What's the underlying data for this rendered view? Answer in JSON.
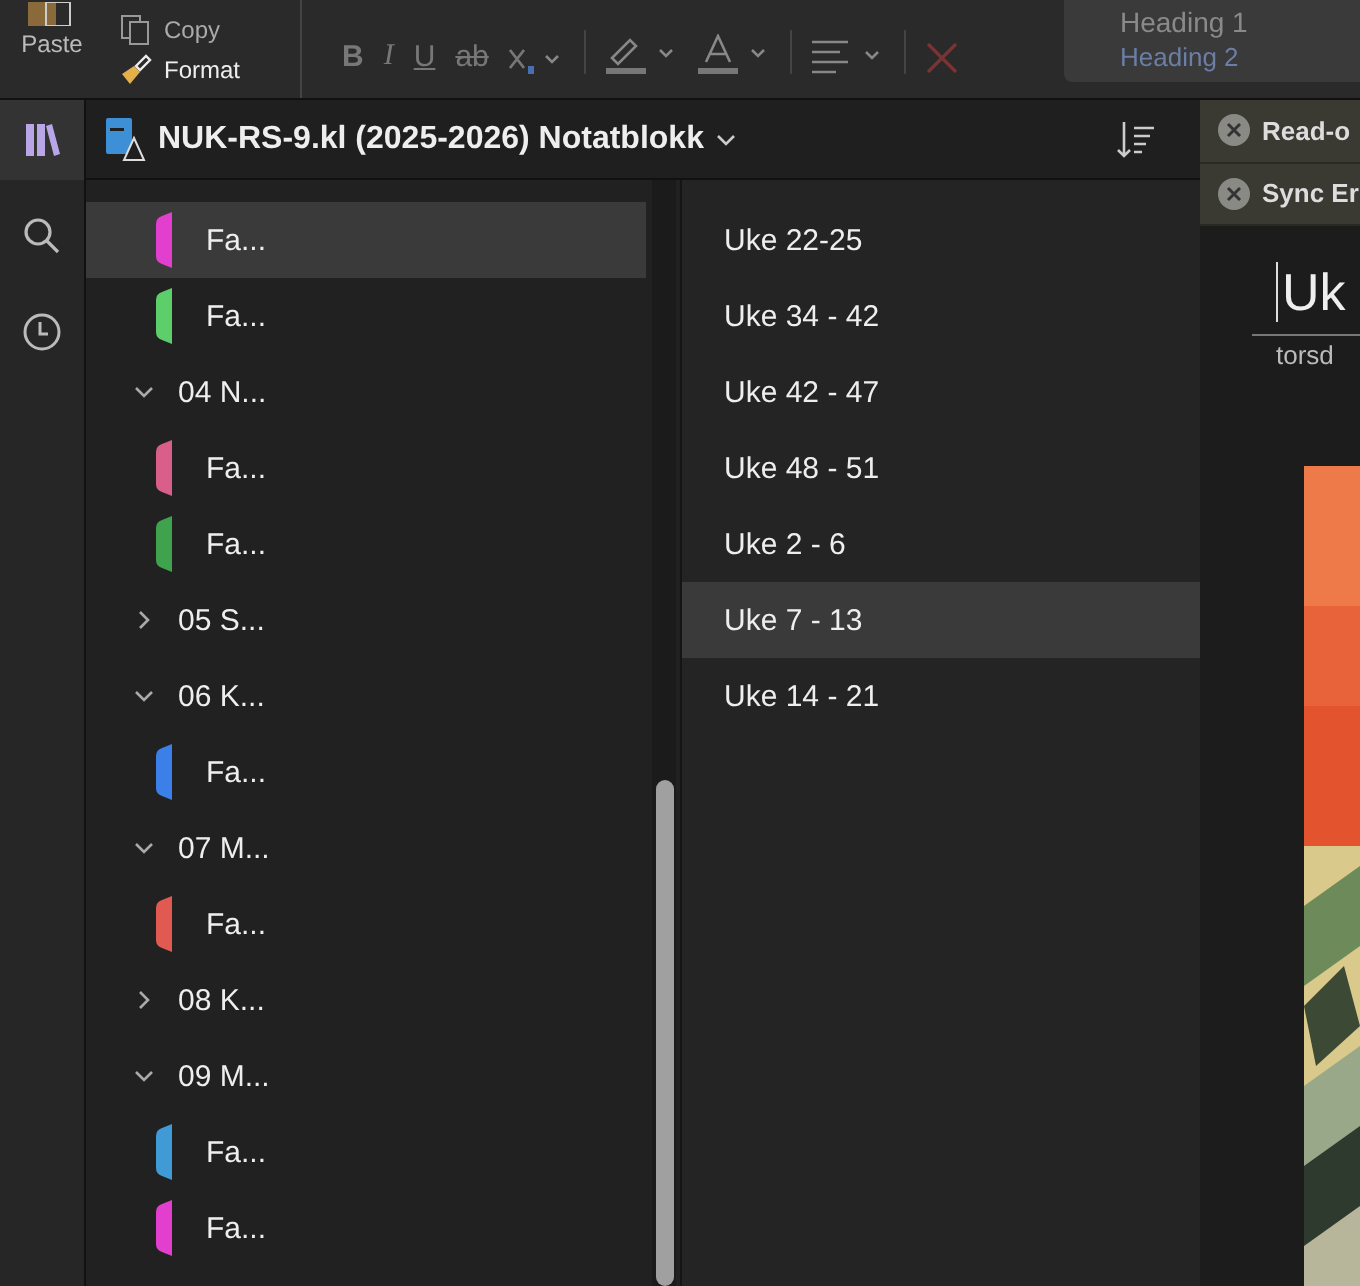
{
  "ribbon": {
    "clipboard": {
      "paste": "Paste",
      "copy": "Copy",
      "format": "Format"
    },
    "font_buttons": [
      {
        "label": "B",
        "kind": "bold"
      },
      {
        "label": "I",
        "kind": "italic"
      },
      {
        "label": "U",
        "kind": "underline"
      },
      {
        "label": "ab",
        "kind": "strike"
      }
    ],
    "styles": [
      "Heading 1",
      "Heading 2"
    ]
  },
  "notebook": {
    "title": "NUK-RS-9.kl (2025-2026) Notatblokk"
  },
  "rail": [
    {
      "kind": "notebooks",
      "selected": true
    },
    {
      "kind": "search",
      "selected": false
    },
    {
      "kind": "recent",
      "selected": false
    }
  ],
  "sections": [
    {
      "kind": "section",
      "label": "Fa...",
      "color": "#e23fcf",
      "selected": true
    },
    {
      "kind": "section",
      "label": "Fa...",
      "color": "#5ccf6a",
      "selected": false
    },
    {
      "kind": "group",
      "label": "04 N...",
      "expanded": true,
      "children": [
        {
          "kind": "section",
          "label": "Fa...",
          "color": "#d95f8a",
          "selected": false
        },
        {
          "kind": "section",
          "label": "Fa...",
          "color": "#3fa34d",
          "selected": false
        }
      ]
    },
    {
      "kind": "group",
      "label": "05 S...",
      "expanded": false
    },
    {
      "kind": "group",
      "label": "06 K...",
      "expanded": true,
      "children": [
        {
          "kind": "section",
          "label": "Fa...",
          "color": "#3b7fe8",
          "selected": false
        }
      ]
    },
    {
      "kind": "group",
      "label": "07 M...",
      "expanded": true,
      "children": [
        {
          "kind": "section",
          "label": "Fa...",
          "color": "#e05a52",
          "selected": false
        }
      ]
    },
    {
      "kind": "group",
      "label": "08 K...",
      "expanded": false
    },
    {
      "kind": "group",
      "label": "09 M...",
      "expanded": true,
      "children": [
        {
          "kind": "section",
          "label": "Fa...",
          "color": "#3f9ad6",
          "selected": false
        },
        {
          "kind": "section",
          "label": "Fa...",
          "color": "#e23fcf",
          "selected": false
        }
      ]
    }
  ],
  "pages": [
    {
      "label": "Uke 22-25",
      "selected": false
    },
    {
      "label": "Uke 34 - 42",
      "selected": false
    },
    {
      "label": "Uke 42 - 47",
      "selected": false
    },
    {
      "label": "Uke 48 - 51",
      "selected": false
    },
    {
      "label": "Uke 2 - 6",
      "selected": false
    },
    {
      "label": "Uke 7 - 13",
      "selected": true
    },
    {
      "label": "Uke 14 - 21",
      "selected": false
    }
  ],
  "notifications": [
    "Read-o",
    "Sync Er"
  ],
  "page": {
    "title": "Uk",
    "date": "torsd"
  }
}
